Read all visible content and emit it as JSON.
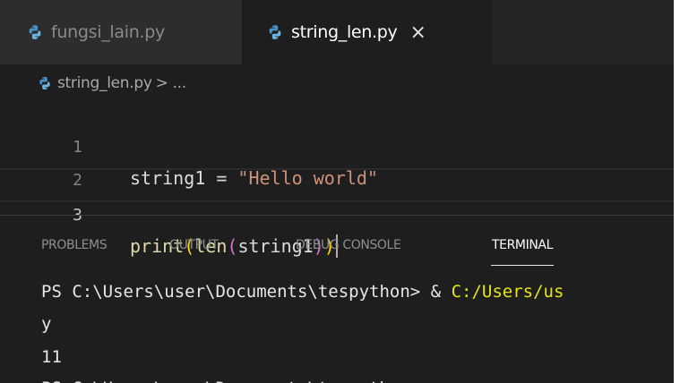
{
  "tabs": [
    {
      "label": "fungsi_lain.py",
      "active": false,
      "icon": "python-file-icon"
    },
    {
      "label": "string_len.py",
      "active": true,
      "icon": "python-file-icon",
      "close": "×"
    }
  ],
  "breadcrumb": {
    "file": "string_len.py",
    "separator": ">",
    "rest": "..."
  },
  "editor": {
    "lines": [
      {
        "number": "1",
        "tokens": {
          "var": "string1",
          "op": " = ",
          "str": "\"Hello world\""
        }
      },
      {
        "number": "2"
      },
      {
        "number": "3",
        "tokens": {
          "fn": "print",
          "p1_open": "(",
          "len": "len",
          "p2_open": "(",
          "arg": "string1",
          "p2_close": ")",
          "p1_close": ")"
        }
      }
    ]
  },
  "panel": {
    "tabs": [
      "PROBLEMS",
      "OUTPUT",
      "DEBUG CONSOLE",
      "TERMINAL"
    ],
    "active_tab": "TERMINAL"
  },
  "terminal": {
    "prompt": "PS C:\\Users\\user\\Documents\\tespython> & ",
    "command_path": "C:/Users/us",
    "line2": "y",
    "line3": "11",
    "line4": "PS C:\\Users\\user\\Documents\\tespython>"
  },
  "colors": {
    "background": "#1e1e1e",
    "tabbar": "#252526",
    "string": "#ce9178",
    "function": "#dcdcaa",
    "bracket1": "#ffd700",
    "bracket2": "#da70d6",
    "terminal_path": "#e5e510"
  }
}
